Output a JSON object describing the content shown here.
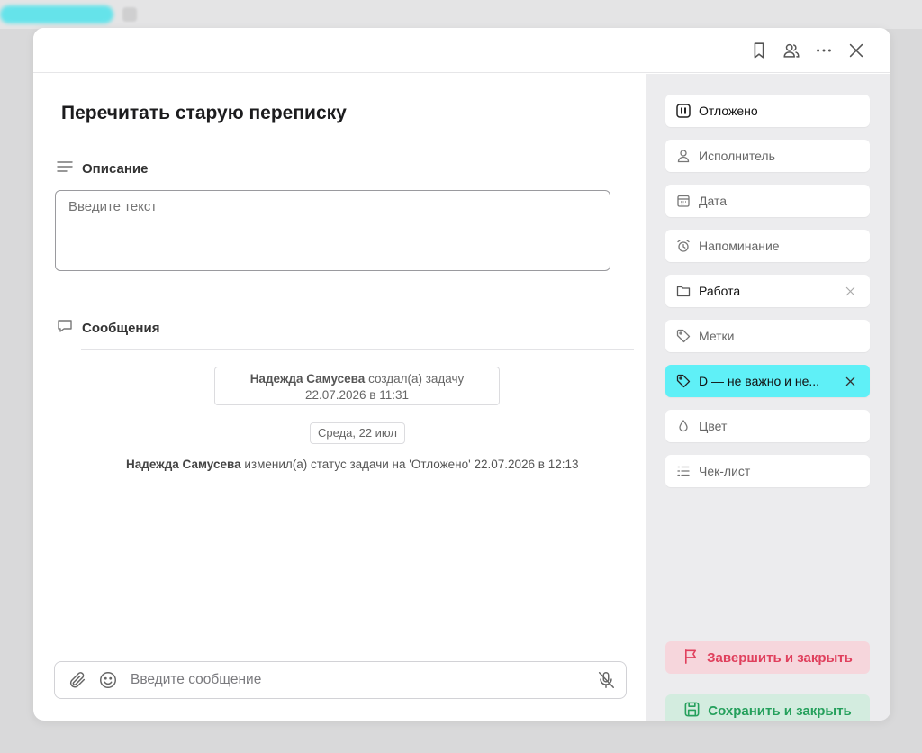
{
  "header": {
    "icons": [
      "bookmark-icon",
      "users-icon",
      "more-icon",
      "close-icon"
    ]
  },
  "task": {
    "title": "Перечитать старую переписку"
  },
  "description": {
    "heading": "Описание",
    "placeholder": "Введите текст",
    "value": ""
  },
  "messages": {
    "heading": "Сообщения",
    "created": {
      "author": "Надежда Самусева",
      "action": "создал(а) задачу",
      "timestamp": "22.07.2026 в 11:31"
    },
    "day_separator": "Среда, 22 июл",
    "status_event": {
      "author": "Надежда Самусева",
      "text": "изменил(а) статус задачи на 'Отложено' 22.07.2026 в 12:13"
    }
  },
  "composer": {
    "placeholder": "Введите сообщение"
  },
  "sidebar": {
    "items": [
      {
        "label": "Отложено",
        "icon": "pause-icon"
      },
      {
        "label": "Исполнитель",
        "icon": "user-icon"
      },
      {
        "label": "Дата",
        "icon": "calendar-icon"
      },
      {
        "label": "Напоминание",
        "icon": "alarm-icon"
      },
      {
        "label": "Работа",
        "icon": "folder-icon"
      },
      {
        "label": "Метки",
        "icon": "tag-icon"
      },
      {
        "label": "D — не важно и не...",
        "icon": "tag-icon"
      },
      {
        "label": "Цвет",
        "icon": "drop-icon"
      },
      {
        "label": "Чек-лист",
        "icon": "checklist-icon"
      }
    ],
    "finish_label": "Завершить и закрыть",
    "save_label": "Сохранить и закрыть"
  },
  "colors": {
    "accent_cyan": "#5ff0f7",
    "finish_bg": "#f6d6dc",
    "finish_text": "#e0405d",
    "save_bg": "#d3ecdf",
    "save_text": "#25a05c",
    "sidebar_bg": "#ececee"
  }
}
